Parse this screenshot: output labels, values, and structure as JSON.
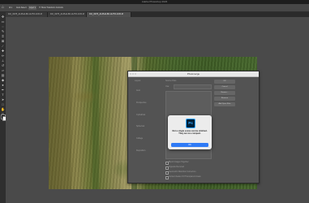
{
  "menubar": {
    "app_title": "Adobe Photoshop 2023"
  },
  "options_bar": {
    "home_icon": "home-icon",
    "items": [
      "Auto-Select:",
      "Layer",
      "Show Transform Controls"
    ]
  },
  "tabs": [
    {
      "label": "DJI_0078_ALPHA-8K-AUTO-10%.tif",
      "active": false
    },
    {
      "label": "DJI_0075_ALPHA-8K-AUTO-10%.tif",
      "active": false
    },
    {
      "label": "DJI_0076_ALPHA-8K-AUTO-10%.tif",
      "active": true
    }
  ],
  "toolbar": {
    "tools": [
      "move-icon",
      "marquee-icon",
      "lasso-icon",
      "quick-select-icon",
      "crop-icon",
      "frame-icon",
      "eyedropper-icon",
      "healing-icon",
      "brush-icon",
      "clone-stamp-icon",
      "history-brush-icon",
      "eraser-icon",
      "gradient-icon",
      "blur-icon",
      "dodge-icon",
      "pen-icon",
      "type-icon",
      "path-select-icon",
      "rectangle-icon",
      "hand-icon",
      "zoom-icon",
      "more-tools-icon"
    ],
    "foreground_color": "#000000",
    "background_color": "#ffffff"
  },
  "dialog": {
    "title": "Photomerge",
    "layout_header": "Layout",
    "source_header": "Source Files",
    "layout_options": [
      "Auto",
      "Perspective",
      "Cylindrical",
      "Spherical",
      "Collage",
      "Reposition"
    ],
    "use_label": "Use:",
    "buttons": [
      "OK",
      "Cancel",
      "Browse...",
      "Remove",
      "Add Open Files"
    ],
    "checkboxes": [
      "Blend Images Together",
      "Vignette Removal",
      "Geometric Distortion Correction",
      "Content Aware Fill Transparent Areas"
    ]
  },
  "alert": {
    "icon_text": "Ps",
    "message": "Not a single scene can be stitched. They are too compact.",
    "ok_label": "OK"
  }
}
